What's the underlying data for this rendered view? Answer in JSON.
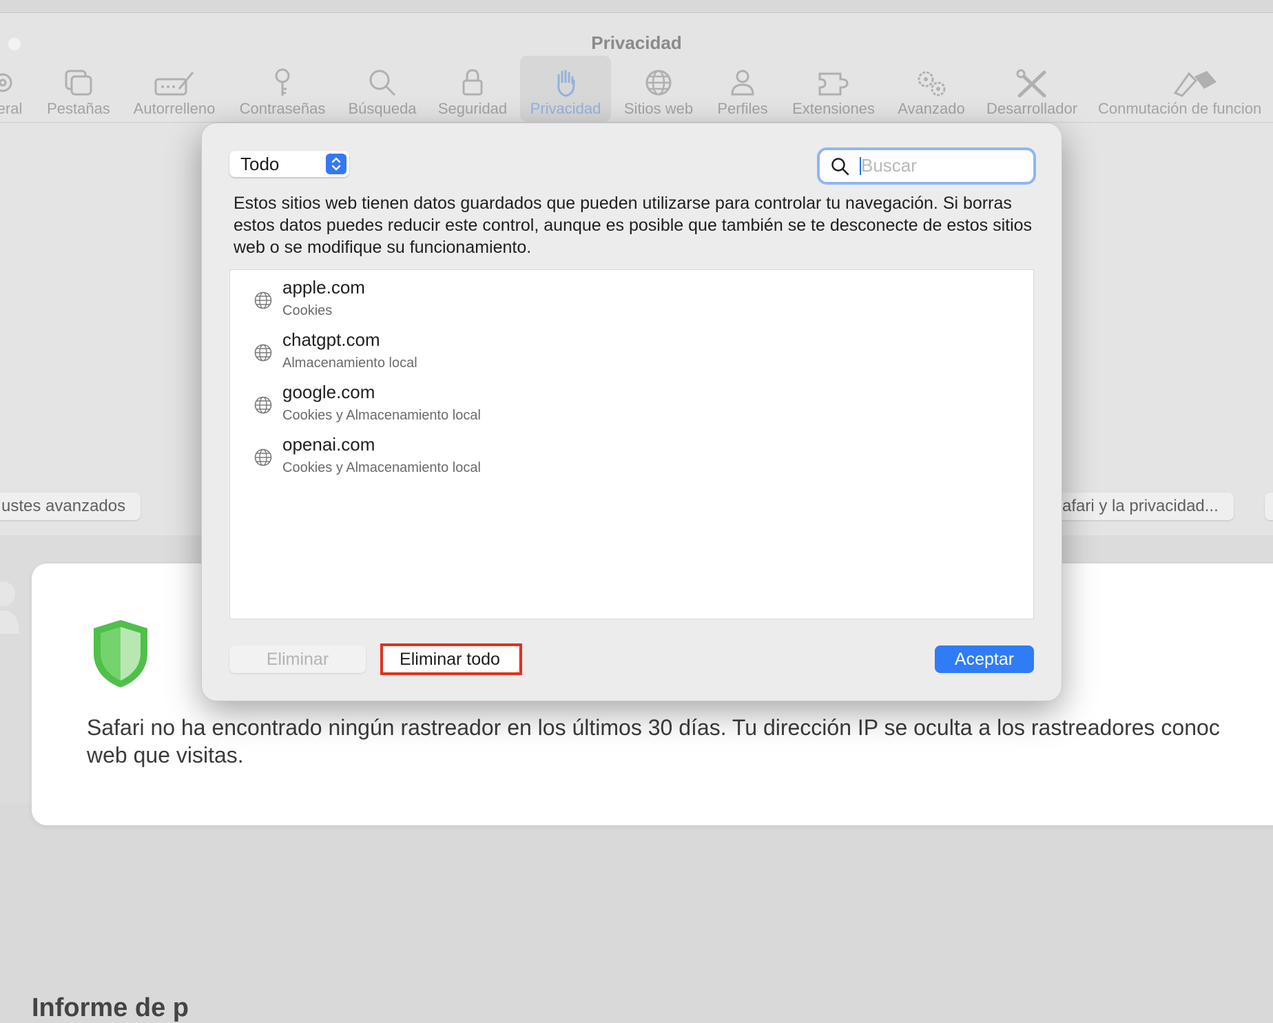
{
  "window": {
    "title": "Privacidad"
  },
  "toolbar": {
    "items": [
      {
        "label": "eral",
        "icon": "gear-icon"
      },
      {
        "label": "Pestañas",
        "icon": "tabs-icon"
      },
      {
        "label": "Autorrelleno",
        "icon": "autofill-icon"
      },
      {
        "label": "Contraseñas",
        "icon": "key-icon"
      },
      {
        "label": "Búsqueda",
        "icon": "search-icon"
      },
      {
        "label": "Seguridad",
        "icon": "lock-icon"
      },
      {
        "label": "Privacidad",
        "icon": "hand-icon",
        "active": true
      },
      {
        "label": "Sitios web",
        "icon": "globe-icon"
      },
      {
        "label": "Perfiles",
        "icon": "person-icon"
      },
      {
        "label": "Extensiones",
        "icon": "puzzle-icon"
      },
      {
        "label": "Avanzado",
        "icon": "gears-icon"
      },
      {
        "label": "Desarrollador",
        "icon": "tools-icon"
      },
      {
        "label": "Conmutación de funcion",
        "icon": "flags-icon"
      }
    ]
  },
  "background": {
    "advanced_button": "ustes avanzados",
    "privacy_button": "afari y la privacidad...",
    "report_title": "Informe de p",
    "report_text_line1": "Safari no ha encontrado ningún rastreador en los últimos 30 días. Tu dirección IP se oculta a los rastreadores conoc",
    "report_text_line2": "web que visitas."
  },
  "dialog": {
    "filter": {
      "value": "Todo"
    },
    "search": {
      "placeholder": "Buscar",
      "value": ""
    },
    "description": "Estos sitios web tienen datos guardados que pueden utilizarse para controlar tu navegación. Si borras estos datos puedes reducir este control, aunque es posible que también se te desconecte de estos sitios web o se modifique su funcionamiento.",
    "sites": [
      {
        "name": "apple.com",
        "data": "Cookies"
      },
      {
        "name": "chatgpt.com",
        "data": "Almacenamiento local"
      },
      {
        "name": "google.com",
        "data": "Cookies y Almacenamiento local"
      },
      {
        "name": "openai.com",
        "data": "Cookies y Almacenamiento local"
      }
    ],
    "buttons": {
      "delete": "Eliminar",
      "delete_all": "Eliminar todo",
      "accept": "Aceptar"
    }
  },
  "colors": {
    "accent": "#2f7cf6",
    "highlight": "#e0311f",
    "active_tab_label": "#93b2dc"
  }
}
